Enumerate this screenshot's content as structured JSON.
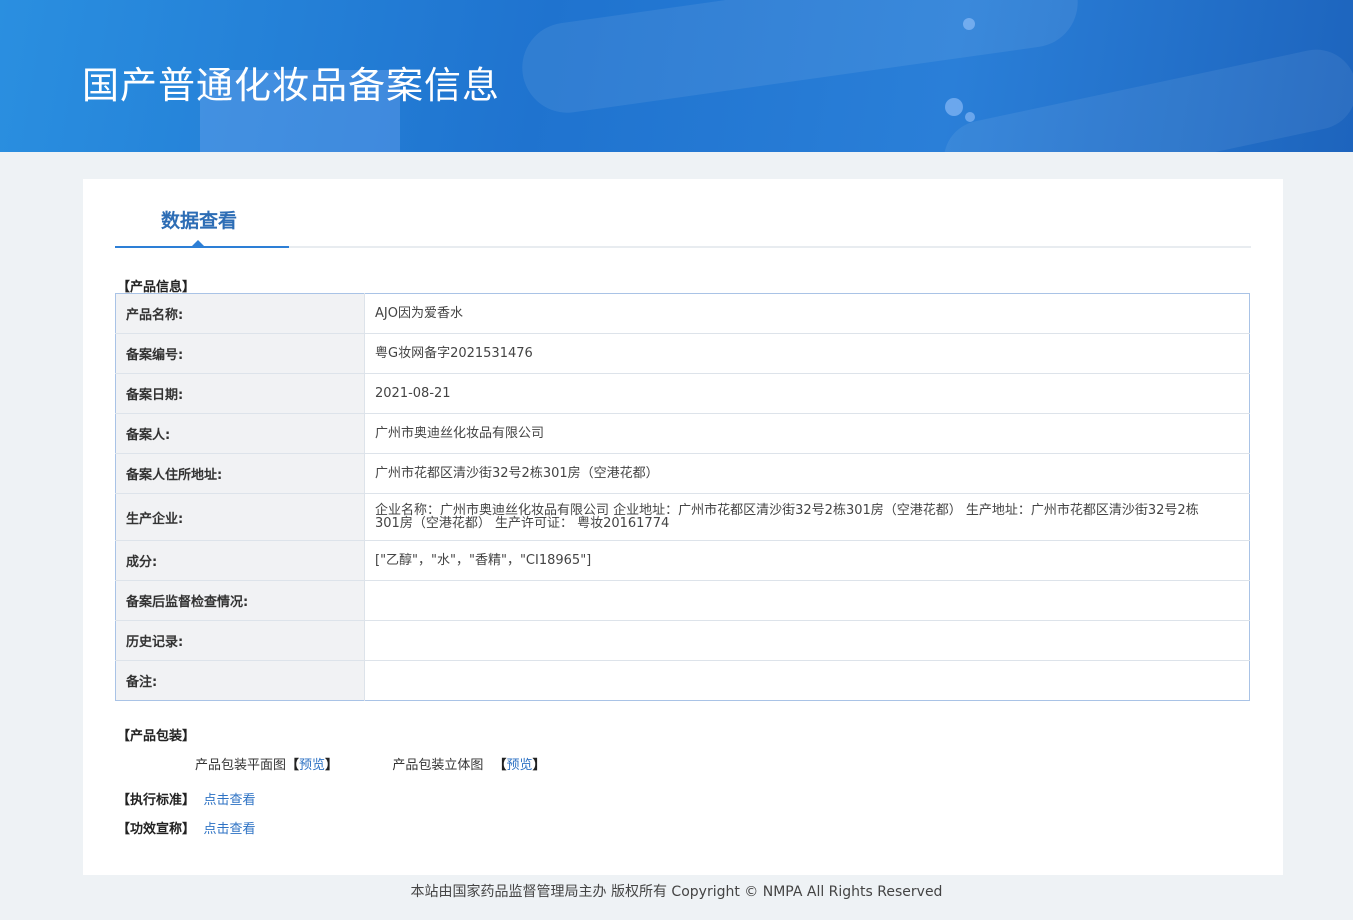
{
  "banner": {
    "title": "国产普通化妆品备案信息"
  },
  "tab": {
    "label": "数据查看"
  },
  "sections": {
    "product_info": "【产品信息】",
    "packaging": "【产品包装】",
    "standard": "【执行标准】",
    "efficacy": "【功效宣称】"
  },
  "rows": [
    {
      "label": "产品名称:",
      "value": "AJO因为爱香水"
    },
    {
      "label": "备案编号:",
      "value": "粤G妆网备字2021531476"
    },
    {
      "label": "备案日期:",
      "value": "2021-08-21"
    },
    {
      "label": "备案人:",
      "value": "广州市奥迪丝化妆品有限公司"
    },
    {
      "label": "备案人住所地址:",
      "value": "广州市花都区清沙街32号2栋301房（空港花都）"
    },
    {
      "label": "生产企业:",
      "value": "企业名称：广州市奥迪丝化妆品有限公司 企业地址：广州市花都区清沙街32号2栋301房（空港花都） 生产地址：广州市花都区清沙街32号2栋301房（空港花都） 生产许可证： 粤妆20161774"
    },
    {
      "label": "成分:",
      "value": "[\"乙醇\"，\"水\"，\"香精\"，\"CI18965\"]"
    },
    {
      "label": "备案后监督检查情况:",
      "value": ""
    },
    {
      "label": "历史记录:",
      "value": ""
    },
    {
      "label": "备注:",
      "value": ""
    }
  ],
  "packaging": {
    "flat_label": "产品包装平面图",
    "solid_label": "产品包装立体图",
    "bracket_open": "【",
    "bracket_close": "】",
    "preview": "预览"
  },
  "links": {
    "view": "点击查看"
  },
  "footer": {
    "text": "本站由国家药品监督管理局主办 版权所有 Copyright © NMPA All Rights Reserved"
  }
}
